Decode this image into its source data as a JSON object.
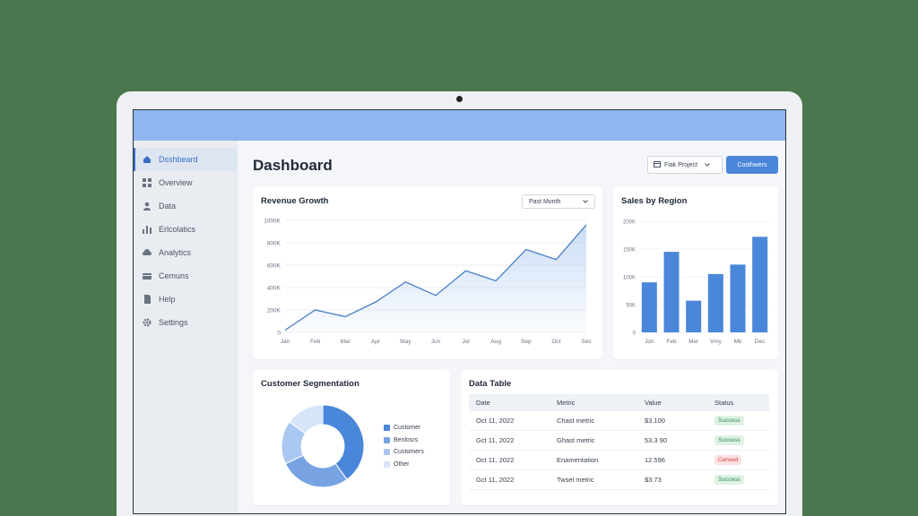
{
  "sidebar": {
    "items": [
      {
        "label": "Dsshbeard",
        "icon": "home-icon",
        "active": true
      },
      {
        "label": "Overview",
        "icon": "grid-icon"
      },
      {
        "label": "Data",
        "icon": "user-icon"
      },
      {
        "label": "Erlcolatics",
        "icon": "bar-chart-icon"
      },
      {
        "label": "Analytics",
        "icon": "cloud-icon"
      },
      {
        "label": "Cemuns",
        "icon": "card-icon"
      },
      {
        "label": "Help",
        "icon": "document-icon"
      },
      {
        "label": "Settings",
        "icon": "gear-icon"
      }
    ]
  },
  "header": {
    "title": "Dashboard",
    "project_select": "Fiak Project",
    "primary_button": "Costhwers"
  },
  "revenue": {
    "title": "Revenue Growth",
    "period": "Past Month"
  },
  "region": {
    "title": "Sales by Region"
  },
  "segmentation": {
    "title": "Customer Segmentation",
    "legend": [
      "Customer",
      "Benlosrs",
      "Customers",
      "Other"
    ]
  },
  "table": {
    "title": "Data Table",
    "headers": [
      "Date",
      "Metric",
      "Value",
      "Status"
    ],
    "rows": [
      {
        "date": "Oct 11, 2022",
        "metric": "Chast metric",
        "value": "$3.100",
        "status": "Success",
        "ok": true
      },
      {
        "date": "Gct 11, 2022",
        "metric": "Ghast metric",
        "value": "53.3 90",
        "status": "Success",
        "ok": true
      },
      {
        "date": "Oct 11, 2022",
        "metric": "Enamentation",
        "value": "12.596",
        "status": "Cenved",
        "ok": false
      },
      {
        "date": "Gct 11, 2022",
        "metric": "Twsel metric",
        "value": "$3.73",
        "status": "Success",
        "ok": true
      }
    ]
  },
  "colors": {
    "accent": "#4a86d9",
    "topbar": "#8fb6ee",
    "success": "#2e8b57",
    "error": "#d04444"
  },
  "chart_data": [
    {
      "type": "area",
      "title": "Revenue Growth",
      "categories": [
        "Jan",
        "Feb",
        "Mar",
        "Apr",
        "May",
        "Jun",
        "Jul",
        "Aug",
        "Sep",
        "Oct",
        "Sec"
      ],
      "tick_labels": [
        "Jan",
        "Feb",
        "Mar",
        "Apr",
        "May",
        "Jun",
        "Jul",
        "Aug",
        "Sep",
        "Oct",
        "Sec"
      ],
      "values": [
        20,
        200,
        140,
        270,
        450,
        330,
        550,
        460,
        740,
        650,
        960
      ],
      "ylim": [
        0,
        1000
      ],
      "yticks": [
        0,
        200,
        400,
        600,
        800,
        1000
      ],
      "ytick_labels": [
        "0",
        "200K",
        "400K",
        "600K",
        "800K",
        "1000K"
      ],
      "grid": true
    },
    {
      "type": "bar",
      "title": "Sales by Region",
      "categories": [
        "Jon",
        "Feb",
        "Mer",
        "Vmy",
        "Mk",
        "Dec"
      ],
      "values": [
        90,
        145,
        57,
        105,
        122,
        172
      ],
      "ylim": [
        0,
        200
      ],
      "yticks": [
        0,
        50,
        100,
        150,
        200
      ],
      "ytick_labels": [
        "0",
        "50K",
        "100K",
        "150K",
        "200K"
      ],
      "grid": true
    },
    {
      "type": "pie",
      "title": "Customer Segmentation",
      "labels": [
        "Customer",
        "Benlosrs",
        "Customers",
        "Other"
      ],
      "values": [
        40,
        28,
        17,
        15
      ],
      "colors": [
        "#4a86d9",
        "#78a3e3",
        "#a9c7f0",
        "#d6e5f8"
      ],
      "donut": true
    }
  ]
}
